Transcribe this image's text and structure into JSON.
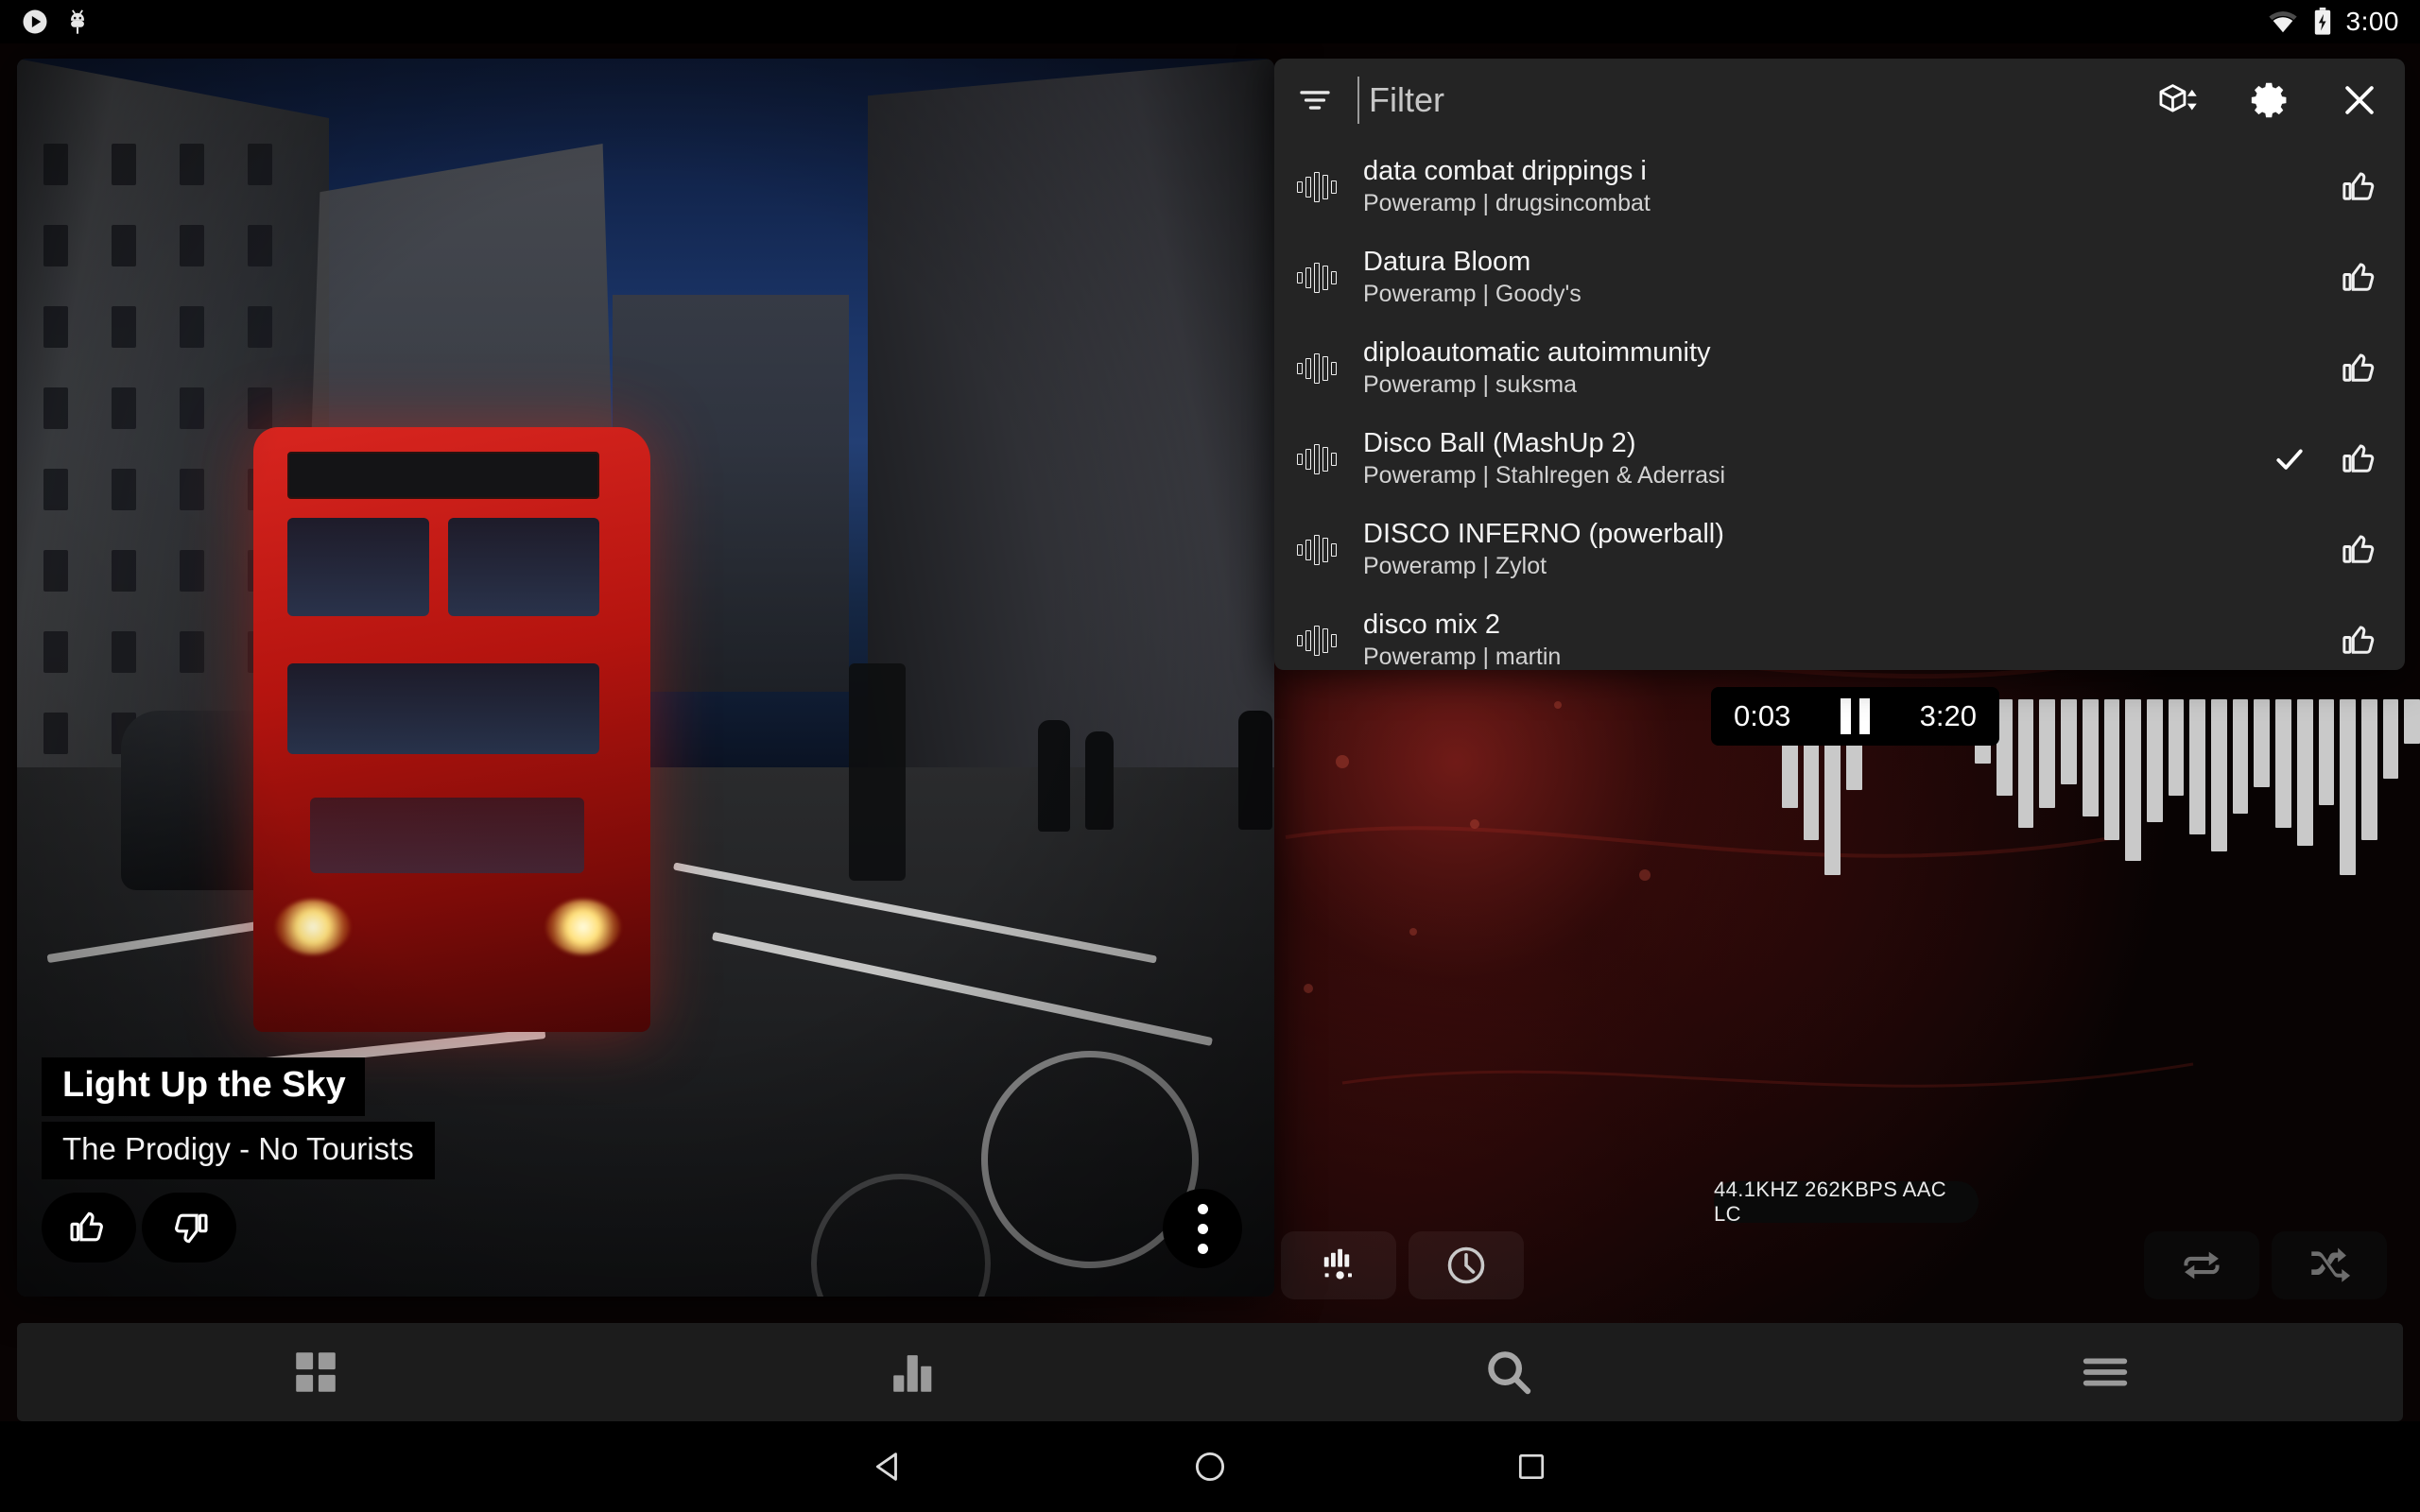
{
  "status_bar": {
    "left_icons": [
      "play-circle-icon",
      "android-bug-icon"
    ],
    "wifi_icon": "wifi-icon",
    "battery_icon": "battery-charging-icon",
    "clock": "3:00"
  },
  "now_playing": {
    "title": "Light Up the Sky",
    "subtitle": "The Prodigy - No Tourists",
    "thumbs_up_icon": "thumbs-up-icon",
    "thumbs_down_icon": "thumbs-down-icon",
    "more_icon": "overflow-menu-icon"
  },
  "player": {
    "elapsed": "0:03",
    "duration": "3:20",
    "transport_state_icon": "pause-icon",
    "format_badge": "44.1KHZ  262KBPS  AAC LC",
    "buttons": [
      {
        "name": "equalizer-button",
        "icon": "equalizer-icon",
        "active": true
      },
      {
        "name": "sleep-timer-button",
        "icon": "clock-icon",
        "active": true
      },
      {
        "name": "repeat-button",
        "icon": "repeat-icon",
        "active": false
      },
      {
        "name": "shuffle-button",
        "icon": "shuffle-icon",
        "active": false
      }
    ],
    "visualizer_bars": [
      74,
      96,
      120,
      62,
      18,
      10,
      12,
      14,
      16,
      44,
      66,
      88,
      74,
      58,
      80,
      96,
      110,
      84,
      66,
      92,
      104,
      78,
      60,
      88,
      100,
      72,
      120,
      96,
      54,
      30
    ]
  },
  "playlist_panel": {
    "filter": {
      "value": "",
      "placeholder": "Filter",
      "icon": "filter-icon"
    },
    "header_icons": [
      {
        "name": "sort-cube-button",
        "icon": "cube-sort-icon"
      },
      {
        "name": "settings-button",
        "icon": "gear-icon"
      },
      {
        "name": "close-button",
        "icon": "close-icon"
      }
    ],
    "tracks": [
      {
        "title": "data combat drippings i",
        "subtitle": "Poweramp | drugsincombat",
        "icon": "waveform-icon",
        "current": false,
        "rating_icon": "thumbs-up-icon"
      },
      {
        "title": "Datura Bloom",
        "subtitle": "Poweramp | Goody's",
        "icon": "waveform-icon",
        "current": false,
        "rating_icon": "thumbs-up-icon"
      },
      {
        "title": "diploautomatic autoimmunity",
        "subtitle": "Poweramp | suksma",
        "icon": "waveform-icon",
        "current": false,
        "rating_icon": "thumbs-up-icon"
      },
      {
        "title": "Disco Ball (MashUp 2)",
        "subtitle": "Poweramp | Stahlregen & Aderrasi",
        "icon": "waveform-icon",
        "current": true,
        "rating_icon": "thumbs-up-icon"
      },
      {
        "title": "DISCO INFERNO (powerball)",
        "subtitle": "Poweramp | Zylot",
        "icon": "waveform-icon",
        "current": false,
        "rating_icon": "thumbs-up-icon"
      },
      {
        "title": "disco mix 2",
        "subtitle": "Poweramp | martin",
        "icon": "waveform-icon",
        "current": false,
        "rating_icon": "thumbs-up-icon"
      }
    ]
  },
  "bottom_nav": [
    {
      "name": "nav-library-button",
      "icon": "grid-icon"
    },
    {
      "name": "nav-equalizer-button",
      "icon": "bar-chart-icon"
    },
    {
      "name": "nav-search-button",
      "icon": "search-icon"
    },
    {
      "name": "nav-menu-button",
      "icon": "hamburger-menu-icon"
    }
  ],
  "system_nav": [
    {
      "name": "system-back-button",
      "icon": "back-triangle-icon"
    },
    {
      "name": "system-home-button",
      "icon": "home-circle-icon"
    },
    {
      "name": "system-recents-button",
      "icon": "recents-square-icon"
    }
  ],
  "colors": {
    "panel_bg": "#242424",
    "app_accent": "#c42e28",
    "nav_bg": "#1c1c1c",
    "icon_active": "#ffffff",
    "icon_inactive": "#6e6e6e"
  }
}
